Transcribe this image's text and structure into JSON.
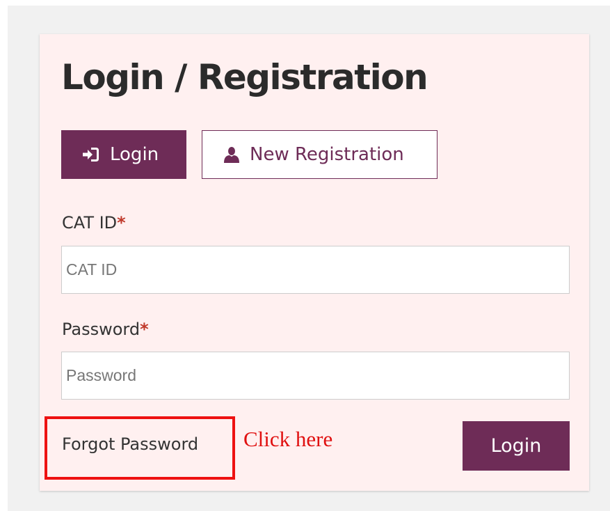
{
  "page": {
    "title": "Login / Registration"
  },
  "tabs": [
    {
      "label": "Login",
      "icon": "sign-in-icon",
      "active": true
    },
    {
      "label": "New Registration",
      "icon": "user-icon",
      "active": false
    }
  ],
  "form": {
    "cat_id": {
      "label": "CAT ID",
      "required_marker": "*",
      "placeholder": "CAT ID",
      "value": ""
    },
    "password": {
      "label": "Password",
      "required_marker": "*",
      "placeholder": "Password",
      "value": ""
    },
    "forgot_password": "Forgot Password",
    "submit_label": "Login"
  },
  "annotation": {
    "text": "Click here",
    "color": "#ee1111"
  },
  "colors": {
    "brand": "#6e2c57",
    "card_background": "#fff0f0",
    "required": "#c0392b"
  }
}
